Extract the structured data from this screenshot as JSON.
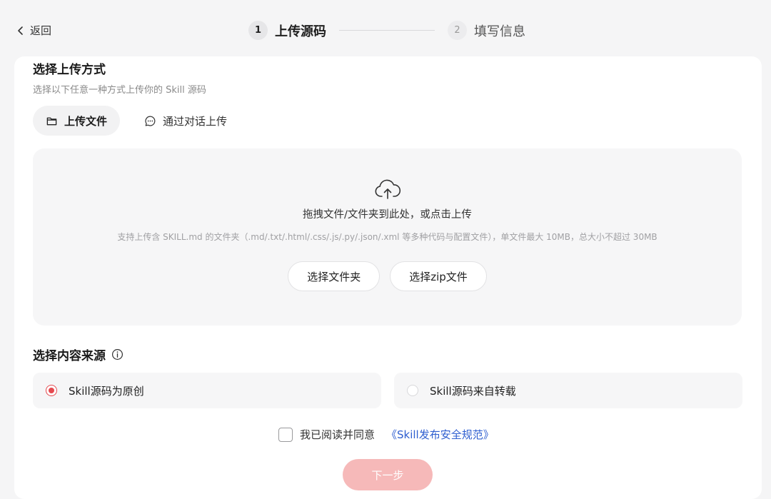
{
  "header": {
    "back_label": "返回",
    "steps": [
      {
        "number": "1",
        "label": "上传源码",
        "active": true
      },
      {
        "number": "2",
        "label": "填写信息",
        "active": false
      }
    ]
  },
  "upload_method": {
    "title": "选择上传方式",
    "subtitle": "选择以下任意一种方式上传你的 Skill 源码",
    "tabs": [
      {
        "label": "上传文件",
        "icon": "folder-icon",
        "active": true
      },
      {
        "label": "通过对话上传",
        "icon": "chat-bubble-icon",
        "active": false
      }
    ]
  },
  "dropzone": {
    "icon": "cloud-upload-icon",
    "main_text": "拖拽文件/文件夹到此处，或点击上传",
    "hint_text": "支持上传含 SKILL.md 的文件夹（.md/.txt/.html/.css/.js/.py/.json/.xml 等多种代码与配置文件），单文件最大 10MB，总大小不超过 30MB",
    "select_folder_label": "选择文件夹",
    "select_zip_label": "选择zip文件"
  },
  "content_source": {
    "title": "选择内容来源",
    "info_icon": "info-icon",
    "options": [
      {
        "label": "Skill源码为原创",
        "checked": true
      },
      {
        "label": "Skill源码来自转载",
        "checked": false
      }
    ]
  },
  "agreement": {
    "text": "我已阅读并同意",
    "link_text": "《Skill发布安全规范》",
    "checked": false
  },
  "next_button_label": "下一步",
  "colors": {
    "accent_red": "#e5494f",
    "disabled_button": "#f6b9b9",
    "link_blue": "#2f5fd0"
  }
}
